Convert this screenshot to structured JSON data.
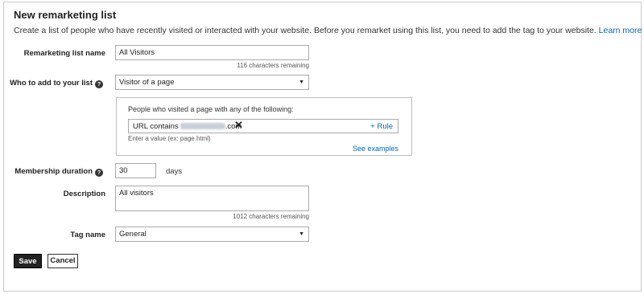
{
  "header": {
    "title": "New remarketing list",
    "intro_text": "Create a list of people who have recently visited or interacted with your website. Before you remarket using this list, you need to add the tag to your website.",
    "learn_more": "Learn more"
  },
  "form": {
    "list_name": {
      "label": "Remarketing list name",
      "value": "All Visitors",
      "remaining": "116 characters remaining"
    },
    "who_to_add": {
      "label": "Who to add to your list",
      "selected": "Visitor of a page"
    },
    "rules": {
      "heading": "People who visited a page with any of the following:",
      "rule_prefix": "URL contains",
      "rule_suffix": ".com",
      "add_rule": "+ Rule",
      "help": "Enter a value (ex: page.html)",
      "see_examples": "See examples"
    },
    "membership": {
      "label": "Membership duration",
      "value": "30",
      "unit": "days"
    },
    "description": {
      "label": "Description",
      "value": "All visitors",
      "remaining": "1012 characters remaining"
    },
    "tag_name": {
      "label": "Tag name",
      "selected": "General"
    }
  },
  "actions": {
    "save": "Save",
    "cancel": "Cancel"
  },
  "icons": {
    "help": "question-circle-icon",
    "dropdown": "caret-down-icon",
    "remove": "close-icon"
  },
  "colors": {
    "link": "#0067b8",
    "primary_button": "#222222"
  }
}
